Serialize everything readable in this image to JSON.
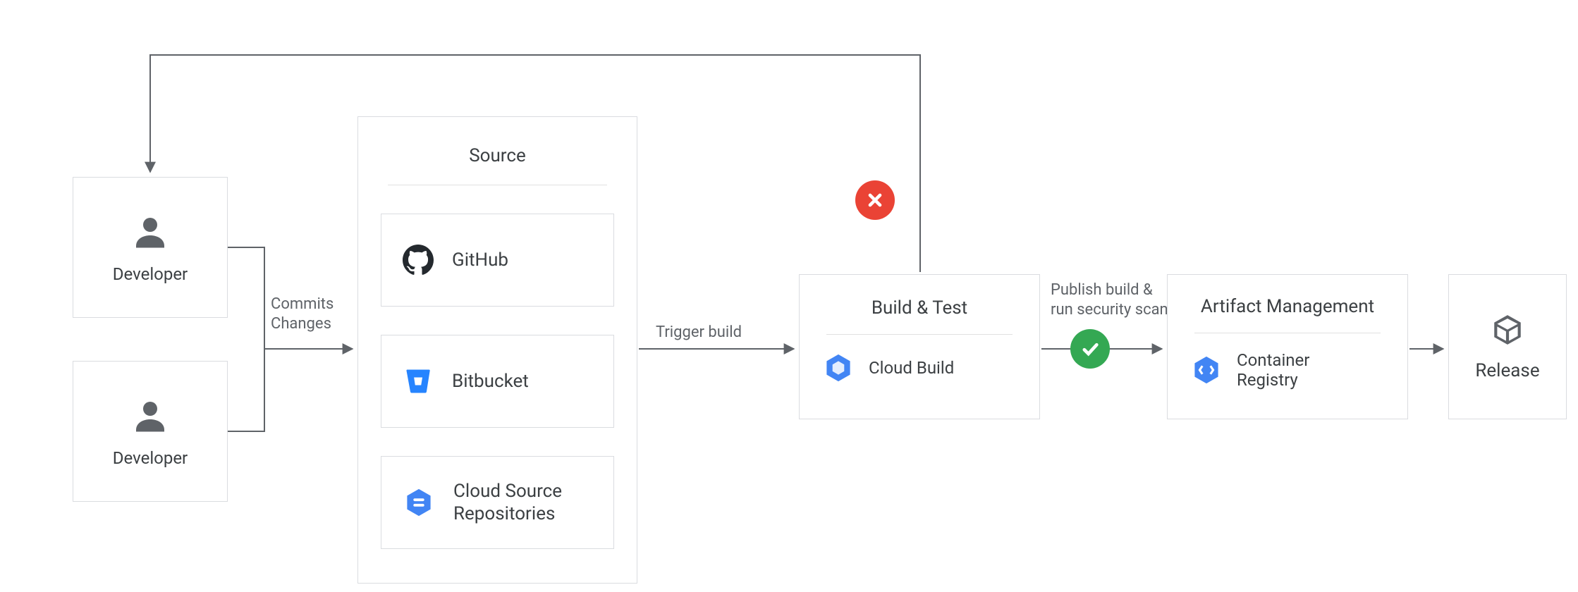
{
  "developers": [
    {
      "label": "Developer"
    },
    {
      "label": "Developer"
    }
  ],
  "edges": {
    "commits": "Commits\nChanges",
    "trigger_build": "Trigger build",
    "publish_scan": "Publish build &\nrun security scan"
  },
  "source_panel": {
    "title": "Source",
    "items": [
      {
        "label": "GitHub",
        "icon": "github-icon"
      },
      {
        "label": "Bitbucket",
        "icon": "bitbucket-icon"
      },
      {
        "label": "Cloud Source\nRepositories",
        "icon": "cloud-source-repositories-icon"
      }
    ]
  },
  "build_test": {
    "title": "Build & Test",
    "product": "Cloud Build",
    "icon": "cloud-build-icon"
  },
  "artifact_mgmt": {
    "title": "Artifact Management",
    "product": "Container\nRegistry",
    "icon": "container-registry-icon"
  },
  "release": {
    "label": "Release",
    "icon": "package-icon"
  },
  "status_badges": {
    "fail": "fail",
    "pass": "pass"
  }
}
